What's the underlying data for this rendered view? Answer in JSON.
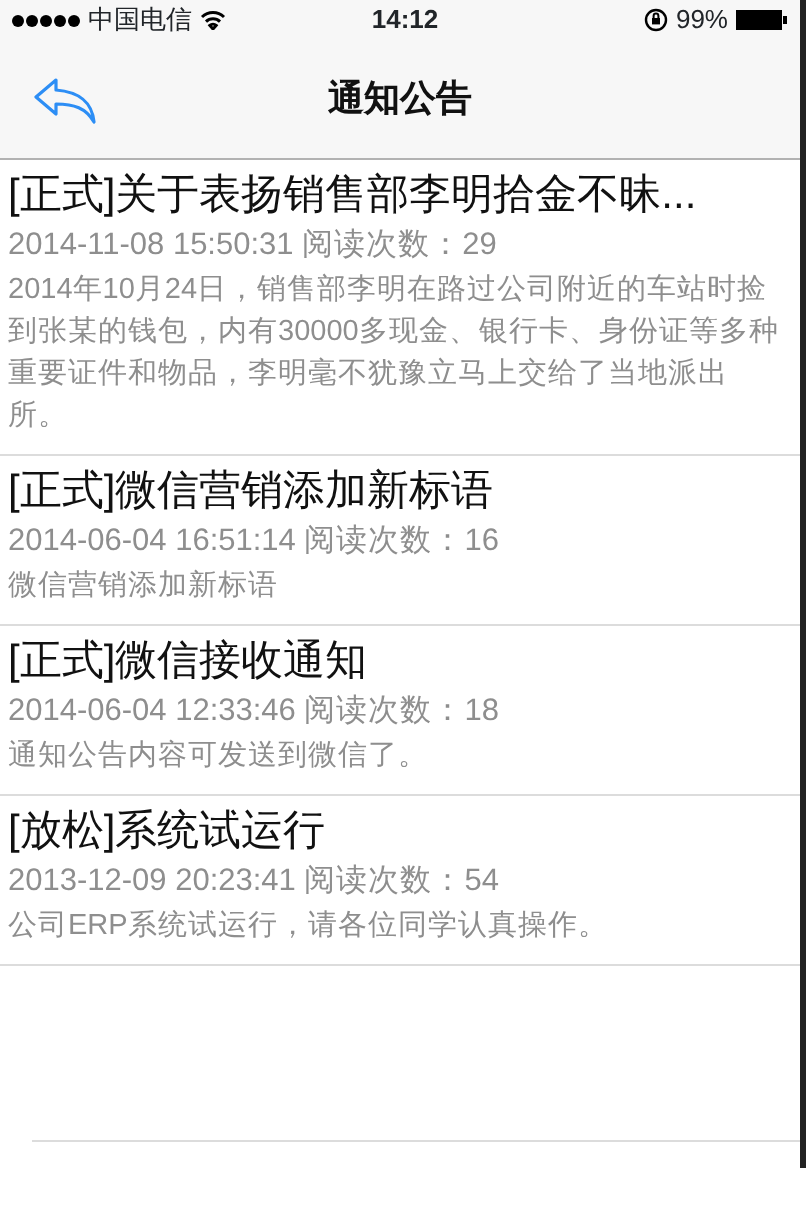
{
  "status_bar": {
    "carrier": "中国电信",
    "time": "14:12",
    "battery": "99%"
  },
  "nav": {
    "title": "通知公告"
  },
  "notices": [
    {
      "title": "[正式]关于表扬销售部李明拾金不昧...",
      "meta": "2014-11-08 15:50:31 阅读次数：29",
      "body": "2014年10月24日，销售部李明在路过公司附近的车站时捡到张某的钱包，内有30000多现金、银行卡、身份证等多种重要证件和物品，李明毫不犹豫立马上交给了当地派出所。"
    },
    {
      "title": "[正式]微信营销添加新标语",
      "meta": "2014-06-04 16:51:14 阅读次数：16",
      "body": "微信营销添加新标语"
    },
    {
      "title": "[正式]微信接收通知",
      "meta": "2014-06-04 12:33:46 阅读次数：18",
      "body": "通知公告内容可发送到微信了。"
    },
    {
      "title": "[放松]系统试运行",
      "meta": "2013-12-09 20:23:41 阅读次数：54",
      "body": "公司ERP系统试运行，请各位同学认真操作。"
    }
  ]
}
